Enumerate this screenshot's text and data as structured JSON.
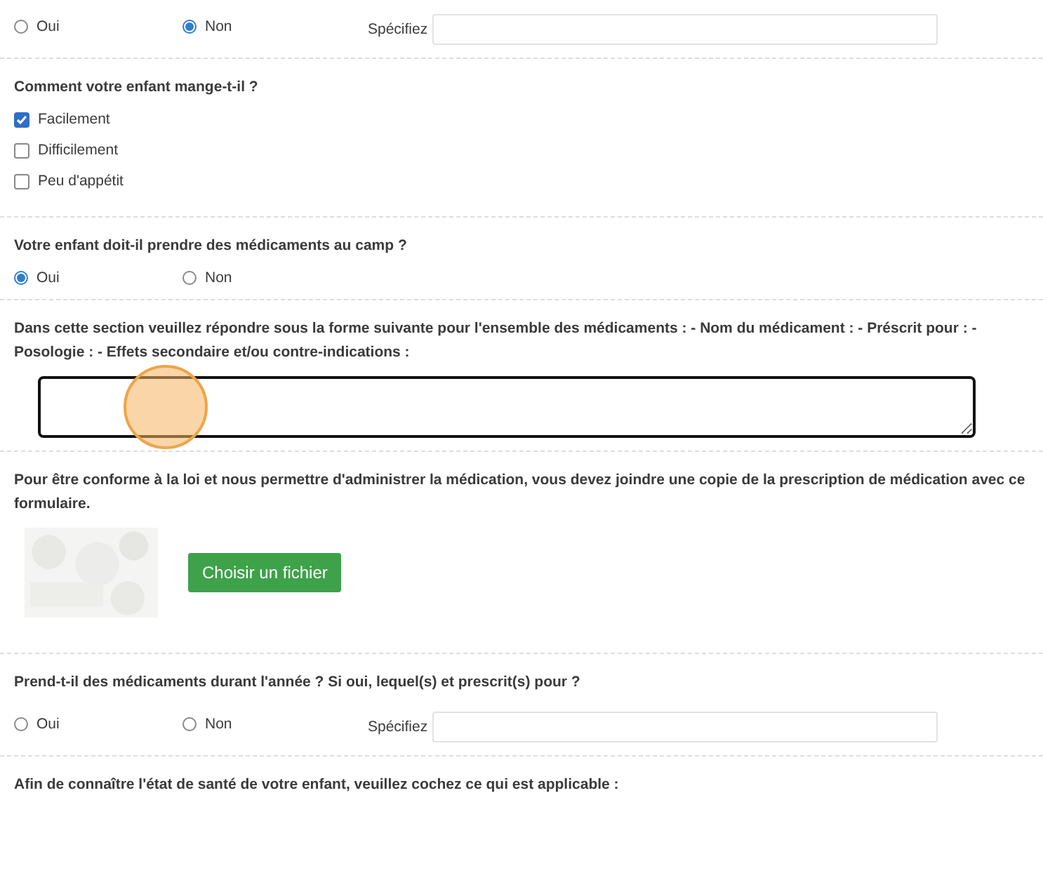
{
  "sections": [
    {
      "kind": "radio",
      "options": [
        {
          "label": "Oui",
          "selected": false
        },
        {
          "label": "Non",
          "selected": true
        }
      ],
      "specify": {
        "label": "Spécifiez"
      }
    },
    {
      "kind": "checkbox",
      "question": "Comment votre enfant mange-t-il ?",
      "options": [
        {
          "label": "Facilement",
          "checked": true
        },
        {
          "label": "Difficilement",
          "checked": false
        },
        {
          "label": "Peu d'appétit",
          "checked": false
        }
      ]
    },
    {
      "kind": "radio",
      "question": "Votre enfant doit-il prendre des médicaments au camp ?",
      "options": [
        {
          "label": "Oui",
          "selected": true
        },
        {
          "label": "Non",
          "selected": false
        }
      ]
    },
    {
      "kind": "textarea",
      "question": "Dans cette section veuillez répondre sous la forme suivante pour l'ensemble des médicaments : - Nom du médicament : - Préscrit pour : - Posologie : - Effets secondaire et/ou contre-indications :",
      "focused": true
    },
    {
      "kind": "file",
      "question": "Pour être conforme à la loi et nous permettre d'administrer la médication, vous devez joindre une copie de la prescription de médication avec ce formulaire.",
      "button": "Choisir un fichier"
    },
    {
      "kind": "radio",
      "question": "Prend-t-il des médicaments durant l'année ? Si oui, lequel(s) et prescrit(s) pour ?",
      "options": [
        {
          "label": "Oui",
          "selected": false
        },
        {
          "label": "Non",
          "selected": false
        }
      ],
      "specify": {
        "label": "Spécifiez"
      }
    },
    {
      "kind": "heading",
      "question": "Afin de connaître l'état de santé de votre enfant, veuillez cochez ce qui est applicable :"
    }
  ]
}
